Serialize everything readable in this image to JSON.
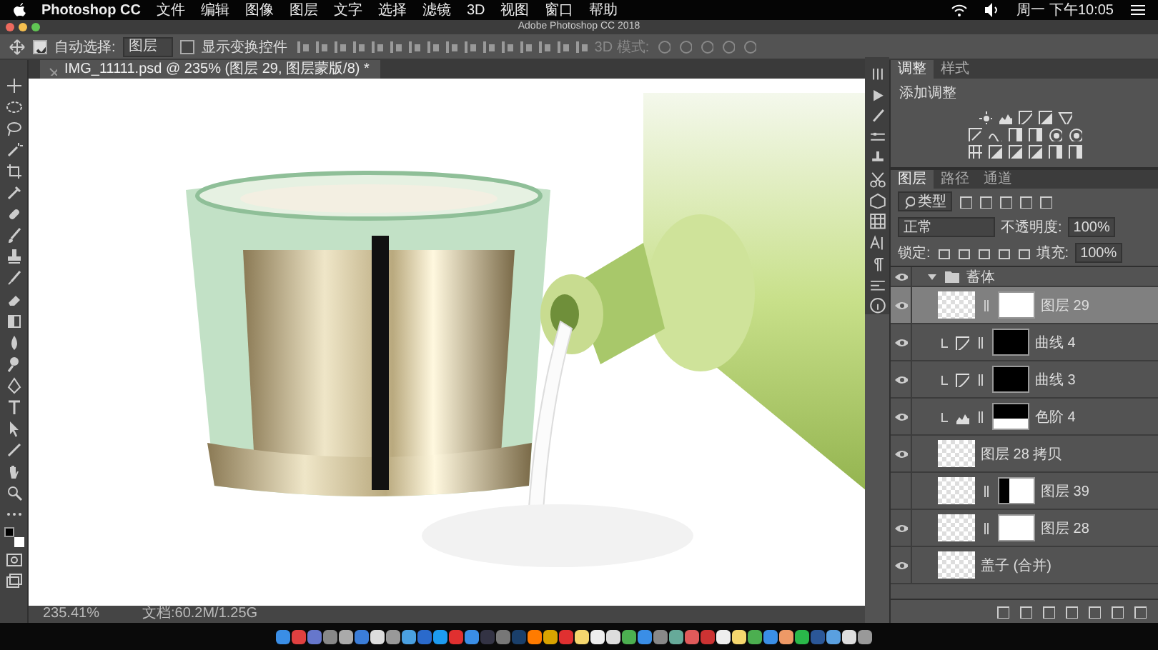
{
  "menubar": {
    "app": "Photoshop CC",
    "menus": [
      "文件",
      "编辑",
      "图像",
      "图层",
      "文字",
      "选择",
      "滤镜",
      "3D",
      "视图",
      "窗口",
      "帮助"
    ],
    "clock": "周一 下午10:05"
  },
  "window": {
    "title": "Adobe Photoshop CC 2018"
  },
  "options_bar": {
    "auto_select": {
      "label": "自动选择:",
      "checked": true,
      "value": "图层"
    },
    "show_transform": {
      "label": "显示变换控件",
      "checked": false
    },
    "mode_3d": "3D 模式:"
  },
  "document_tab": {
    "title": "IMG_11111.psd @ 235% (图层 29, 图层蒙版/8) *"
  },
  "adjustments_panel": {
    "tabs": [
      {
        "label": "调整",
        "selected": true
      },
      {
        "label": "样式",
        "selected": false
      }
    ],
    "heading": "添加调整"
  },
  "layers_panel": {
    "tabs": [
      {
        "label": "图层",
        "selected": true
      },
      {
        "label": "路径",
        "selected": false
      },
      {
        "label": "通道",
        "selected": false
      }
    ],
    "filter": "类型",
    "blend_mode": "正常",
    "opacity_label": "不透明度:",
    "opacity": "100%",
    "lock_label": "锁定:",
    "fill_label": "填充:",
    "fill": "100%",
    "layers": [
      {
        "kind": "group",
        "name": "蓄体",
        "visible": true,
        "expanded": true,
        "selected": false,
        "children": [
          {
            "kind": "pixel",
            "name": "图层 29",
            "visible": true,
            "selected": true,
            "mask": {
              "kind": "reveal"
            }
          },
          {
            "kind": "curves",
            "name": "曲线 4",
            "visible": true,
            "selected": false,
            "mask": {
              "kind": "hide"
            }
          },
          {
            "kind": "curves",
            "name": "曲线 3",
            "visible": true,
            "selected": false,
            "mask": {
              "kind": "hide"
            }
          },
          {
            "kind": "levels",
            "name": "色阶 4",
            "visible": true,
            "selected": false,
            "mask": {
              "kind": "hide-top"
            }
          },
          {
            "kind": "pixel",
            "name": "图层 28 拷贝",
            "visible": true,
            "selected": false
          },
          {
            "kind": "pixel",
            "name": "图层 39",
            "visible": false,
            "selected": false,
            "mask": {
              "kind": "hide-left"
            }
          },
          {
            "kind": "pixel",
            "name": "图层 28",
            "visible": true,
            "selected": false,
            "mask": {
              "kind": "reveal"
            }
          },
          {
            "kind": "pixel",
            "name": "盖子 (合并)",
            "visible": true,
            "selected": false
          }
        ]
      }
    ]
  },
  "status_bar": {
    "zoom": "235.41%",
    "doc_size": "文档:60.2M/1.25G"
  }
}
